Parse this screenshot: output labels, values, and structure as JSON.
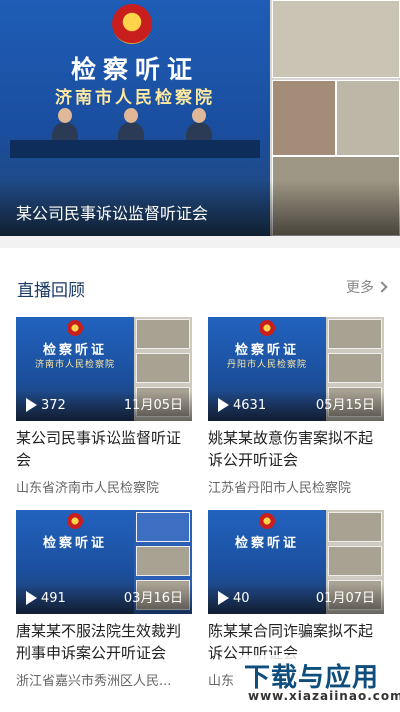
{
  "hero": {
    "banner_title": "检察听证",
    "banner_subtitle": "济南市人民检察院",
    "caption": "某公司民事诉讼监督听证会"
  },
  "section": {
    "title": "直播回顾",
    "more_label": "更多"
  },
  "cards": [
    {
      "views": "372",
      "date": "11月05日",
      "title": "某公司民事诉讼监督听证会",
      "org": "山东省济南市人民检察院",
      "thumb_title": "检察听证",
      "thumb_sub": "济南市人民检察院"
    },
    {
      "views": "4631",
      "date": "05月15日",
      "title": "姚某某故意伤害案拟不起诉公开听证会",
      "org": "江苏省丹阳市人民检察院",
      "thumb_title": "检察听证",
      "thumb_sub": "丹阳市人民检察院"
    },
    {
      "views": "491",
      "date": "03月16日",
      "title": "唐某某不服法院生效裁判刑事申诉案公开听证会",
      "org": "浙江省嘉兴市秀洲区人民...",
      "thumb_title": "检察听证",
      "thumb_sub": ""
    },
    {
      "views": "40",
      "date": "01月07日",
      "title": "陈某某合同诈骗案拟不起诉公开听证会",
      "org": "山东",
      "thumb_title": "检察听证",
      "thumb_sub": ""
    }
  ],
  "watermark": {
    "text": "下载与应用",
    "url": "www.xiazaiinao.com"
  }
}
